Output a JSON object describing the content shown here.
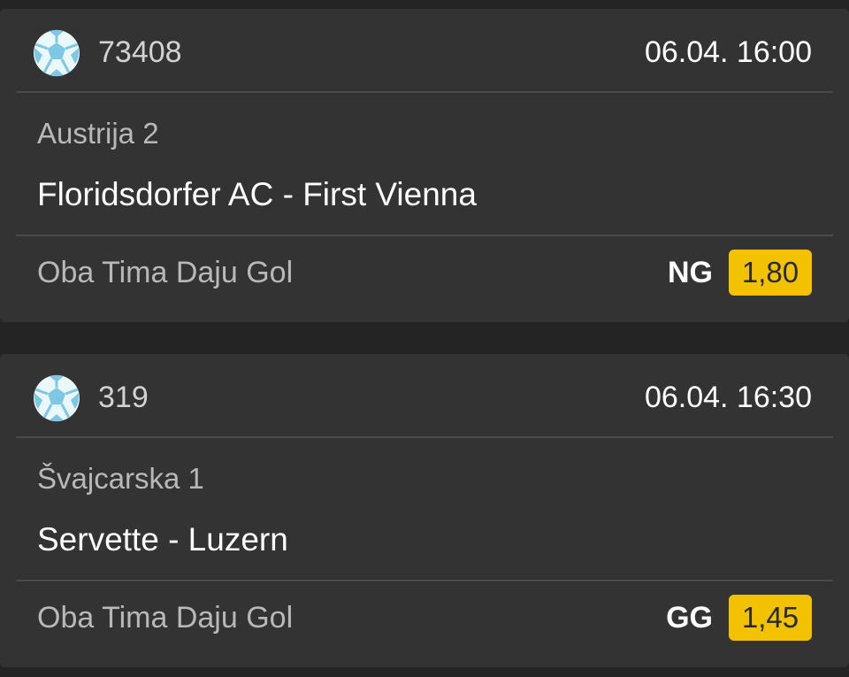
{
  "matches": [
    {
      "icon": "soccer-ball-icon",
      "event_id": "73408",
      "kickoff": "06.04. 16:00",
      "league": "Austrija 2",
      "teams": "Floridsdorfer AC - First Vienna",
      "market": "Oba Tima Daju Gol",
      "pick": "NG",
      "odds": "1,80"
    },
    {
      "icon": "soccer-ball-icon",
      "event_id": "319",
      "kickoff": "06.04. 16:30",
      "league": "Švajcarska 1",
      "teams": "Servette - Luzern",
      "market": "Oba Tima Daju Gol",
      "pick": "GG",
      "odds": "1,45"
    }
  ],
  "colors": {
    "background": "#242424",
    "card": "#333333",
    "divider": "#4a4a4a",
    "odds_badge": "#f2c200",
    "ball": "#7ec8e3"
  }
}
